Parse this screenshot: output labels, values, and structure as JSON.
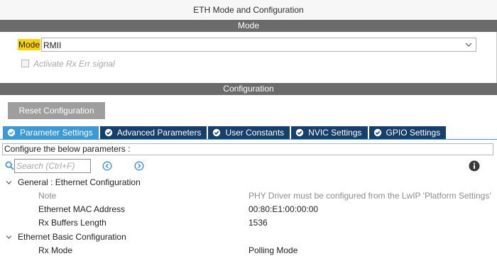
{
  "window": {
    "title": "ETH Mode and Configuration"
  },
  "mode_section": {
    "header": "Mode",
    "mode_label": "Mode",
    "mode_value": "RMII",
    "checkbox_label": "Activate Rx Err signal",
    "checkbox_checked": false
  },
  "config_section": {
    "header": "Configuration",
    "reset_label": "Reset Configuration",
    "tabs": [
      {
        "label": "Parameter Settings",
        "active": true
      },
      {
        "label": "Advanced Parameters",
        "active": false
      },
      {
        "label": "User Constants",
        "active": false
      },
      {
        "label": "NVIC Settings",
        "active": false
      },
      {
        "label": "GPIO Settings",
        "active": false
      }
    ],
    "caption": "Configure the below parameters :",
    "search_placeholder": "Search (Ctrl+F)",
    "search_value": "",
    "groups": [
      {
        "title": "General : Ethernet Configuration",
        "expanded": true,
        "rows": [
          {
            "name": "Note",
            "value": "PHY Driver must be configured from the LwIP 'Platform Settings'",
            "muted": true
          },
          {
            "name": "Ethernet MAC Address",
            "value": "00:80:E1:00:00:00",
            "muted": false
          },
          {
            "name": "Rx Buffers Length",
            "value": "1536",
            "muted": false
          }
        ]
      },
      {
        "title": "Ethernet Basic Configuration",
        "expanded": true,
        "rows": [
          {
            "name": "Rx Mode",
            "value": "Polling Mode",
            "muted": false
          }
        ]
      }
    ]
  },
  "colors": {
    "section_header": "#6b6b6b",
    "tab_active": "#3b9ad4",
    "tab_inactive": "#173f6b",
    "mode_highlight": "#ffd200",
    "reset_button": "#9e9e9e"
  },
  "icons": {
    "tab_icon": "check-circle-icon",
    "search": "search-icon",
    "prev": "circle-arrow-left-icon",
    "next": "circle-arrow-right-icon",
    "info": "info-circle-icon",
    "caret": "chevron-down-icon",
    "select": "chevron-down-icon"
  }
}
